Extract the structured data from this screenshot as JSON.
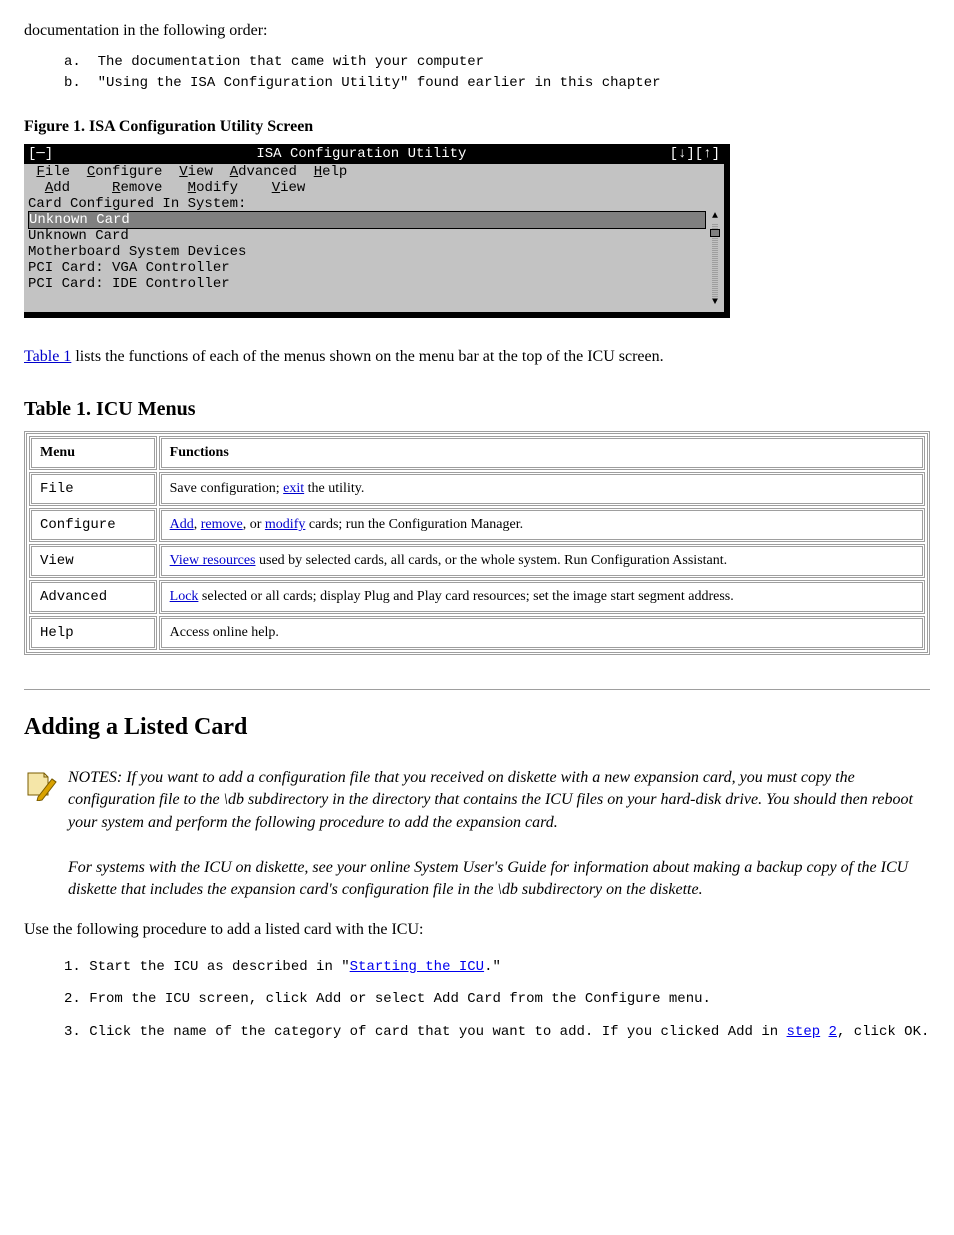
{
  "intro": "documentation in the following order:",
  "doc_order": [
    "a.  The documentation that came with your computer",
    "b.  \"Using the ISA Configuration Utility\" found earlier in this chapter"
  ],
  "figure_caption": "Figure 1. ISA Configuration Utility Screen",
  "tui": {
    "sysbox": "[─]",
    "title": "ISA Configuration Utility",
    "arrows": "[↓][↑]",
    "menu": [
      "File",
      "Configure",
      "View",
      "Advanced",
      "Help"
    ],
    "submenu": [
      "Add",
      "Remove",
      "Modify",
      "View"
    ],
    "list_label": "Card Configured In System:",
    "rows": [
      {
        "label": "Unknown Card",
        "selected": true
      },
      {
        "label": "Unknown Card",
        "selected": false
      },
      {
        "label": "Motherboard System Devices",
        "selected": false
      },
      {
        "label": "PCI Card: VGA Controller",
        "selected": false
      },
      {
        "label": "PCI Card: IDE Controller",
        "selected": false
      }
    ]
  },
  "after_figure": {
    "before_link": "Table 1",
    "after_link": " lists the functions of each of the menus shown on the menu bar at the top of the ICU screen."
  },
  "table_section_title": "Table 1. ICU Menus",
  "table": {
    "headers": [
      "Menu",
      "Functions"
    ],
    "rows": [
      {
        "menu": "File",
        "func_prefix": "Save configuration; ",
        "func_link": "exit",
        "func_suffix": " the utility."
      },
      {
        "menu": "Configure",
        "func_links": [
          "Add",
          "remove",
          "modify"
        ],
        "func_middle": ", ",
        "func_join": ", or ",
        "func_suffix": " cards; run the Configuration Manager."
      },
      {
        "menu": "View",
        "func_link": "View resources",
        "func_suffix": " used by selected cards, all cards, or the whole system. Run Configuration Assistant."
      },
      {
        "menu": "Advanced",
        "func_link": "Lock",
        "func_middle": " selected or all cards; display Plug and Play card resources; set the image start segment address."
      },
      {
        "menu": "Help",
        "func": "Access online help."
      }
    ]
  },
  "addcard": {
    "heading": "Adding a Listed Card",
    "note": "NOTES: If you want to add a configuration file that you received on diskette with a new expansion card, you must copy the configuration file to the \\db subdirectory in the directory that contains the ICU files on your hard-disk drive. You should then reboot your system and perform the following procedure to add the expansion card.",
    "note2_before": "For systems with the ICU on diskette, see your online ",
    "note2_link": "System User's Guide",
    "note2_after": " for information about making a backup copy of the ICU diskette that includes the expansion card's configuration file in the \\db subdirectory on the diskette.",
    "body1": "Use the following procedure to add a listed card with the ICU:",
    "steps_lead": "1.  Start the ICU as described in \"",
    "steps_link": "Starting the ICU",
    "steps_after": ".\"",
    "steps2": "2.  From the ICU screen, click Add or select Add Card from the Configure menu.",
    "steps3_lead": "3.  Click the name of the category of card that you want to add. If you clicked Add in ",
    "steps3_link": "step",
    "steps3_link2": "2",
    "steps3_after": ", click OK."
  }
}
